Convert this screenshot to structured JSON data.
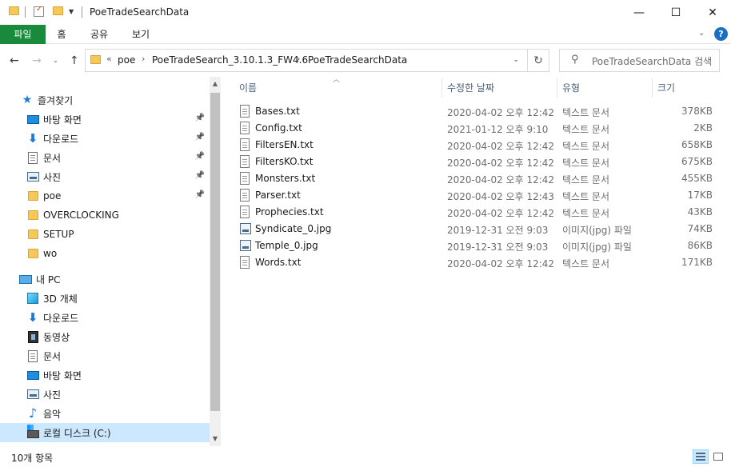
{
  "window": {
    "title": "PoeTradeSearchData",
    "minimize": "—",
    "maximize": "☐",
    "close": "✕"
  },
  "ribbon": {
    "tabs": [
      "파일",
      "홈",
      "공유",
      "보기"
    ],
    "help": "?"
  },
  "address": {
    "overflow": "«",
    "crumbs": [
      "poe",
      "PoeTradeSearch_3.10.1.3_FW4.6",
      "PoeTradeSearchData"
    ],
    "search_placeholder": "PoeTradeSearchData 검색"
  },
  "nav": {
    "quick_access": "즐겨찾기",
    "quick_items": [
      {
        "label": "바탕 화면",
        "icon": "desktop-icon",
        "pinned": true
      },
      {
        "label": "다운로드",
        "icon": "download-icon",
        "pinned": true
      },
      {
        "label": "문서",
        "icon": "documents-icon",
        "pinned": true
      },
      {
        "label": "사진",
        "icon": "pictures-icon",
        "pinned": true
      },
      {
        "label": "poe",
        "icon": "folder-icon",
        "pinned": true
      },
      {
        "label": "OVERCLOCKING",
        "icon": "folder-icon",
        "pinned": false
      },
      {
        "label": "SETUP",
        "icon": "folder-icon",
        "pinned": false
      },
      {
        "label": "wo",
        "icon": "folder-icon",
        "pinned": false
      }
    ],
    "this_pc": "내 PC",
    "pc_items": [
      {
        "label": "3D 개체",
        "icon": "3d-objects-icon"
      },
      {
        "label": "다운로드",
        "icon": "download-icon"
      },
      {
        "label": "동영상",
        "icon": "videos-icon"
      },
      {
        "label": "문서",
        "icon": "documents-icon"
      },
      {
        "label": "바탕 화면",
        "icon": "desktop-icon"
      },
      {
        "label": "사진",
        "icon": "pictures-icon"
      },
      {
        "label": "음악",
        "icon": "music-icon"
      },
      {
        "label": "로컬 디스크 (C:)",
        "icon": "drive-icon"
      }
    ]
  },
  "columns": {
    "name": "이름",
    "date": "수정한 날짜",
    "type": "유형",
    "size": "크기"
  },
  "files": [
    {
      "name": "Bases.txt",
      "date": "2020-04-02 오후 12:42",
      "type": "텍스트 문서",
      "size": "378KB",
      "icon": "text-file-icon"
    },
    {
      "name": "Config.txt",
      "date": "2021-01-12 오후 9:10",
      "type": "텍스트 문서",
      "size": "2KB",
      "icon": "text-file-icon"
    },
    {
      "name": "FiltersEN.txt",
      "date": "2020-04-02 오후 12:42",
      "type": "텍스트 문서",
      "size": "658KB",
      "icon": "text-file-icon"
    },
    {
      "name": "FiltersKO.txt",
      "date": "2020-04-02 오후 12:42",
      "type": "텍스트 문서",
      "size": "675KB",
      "icon": "text-file-icon"
    },
    {
      "name": "Monsters.txt",
      "date": "2020-04-02 오후 12:42",
      "type": "텍스트 문서",
      "size": "455KB",
      "icon": "text-file-icon"
    },
    {
      "name": "Parser.txt",
      "date": "2020-04-02 오후 12:43",
      "type": "텍스트 문서",
      "size": "17KB",
      "icon": "text-file-icon"
    },
    {
      "name": "Prophecies.txt",
      "date": "2020-04-02 오후 12:42",
      "type": "텍스트 문서",
      "size": "43KB",
      "icon": "text-file-icon"
    },
    {
      "name": "Syndicate_0.jpg",
      "date": "2019-12-31 오전 9:03",
      "type": "이미지(jpg) 파일",
      "size": "74KB",
      "icon": "image-file-icon"
    },
    {
      "name": "Temple_0.jpg",
      "date": "2019-12-31 오전 9:03",
      "type": "이미지(jpg) 파일",
      "size": "86KB",
      "icon": "image-file-icon"
    },
    {
      "name": "Words.txt",
      "date": "2020-04-02 오후 12:42",
      "type": "텍스트 문서",
      "size": "171KB",
      "icon": "text-file-icon"
    }
  ],
  "status": {
    "count": "10개 항목"
  },
  "colors": {
    "file_tab": "#19893b",
    "selection": "#cce8ff",
    "folder": "#f6c85a",
    "help": "#1a6fc4"
  }
}
